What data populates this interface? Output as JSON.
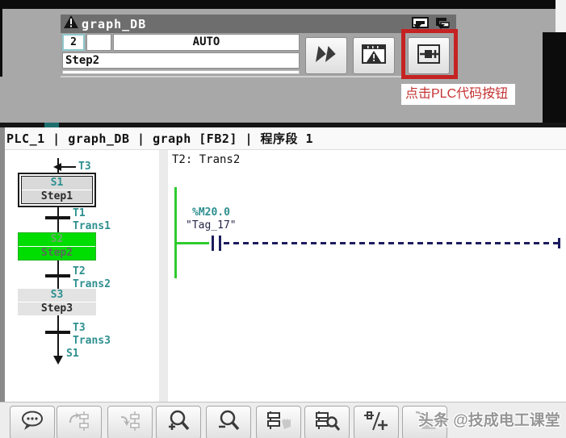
{
  "window": {
    "title": "graph_DB",
    "step_number": "2",
    "mode": "AUTO",
    "current_step": "Step2",
    "buttons": [
      {
        "icon": "fast-forward-icon"
      },
      {
        "icon": "warning-window-icon"
      },
      {
        "icon": "plc-code-icon"
      }
    ]
  },
  "callout": {
    "text": "点击PLC代码按钮"
  },
  "breadcrumb": {
    "text": "PLC_1 | graph_DB | graph [FB2] | 程序段 1"
  },
  "sequence": {
    "entry_transition": "T3",
    "steps": [
      {
        "id": "S1",
        "name": "Step1",
        "state": "selected"
      },
      {
        "id": "S2",
        "name": "Step2",
        "state": "active"
      },
      {
        "id": "S3",
        "name": "Step3",
        "state": "normal"
      }
    ],
    "transitions": [
      {
        "id": "T1",
        "name": "Trans1"
      },
      {
        "id": "T2",
        "name": "Trans2"
      },
      {
        "id": "T3",
        "name": "Trans3"
      }
    ],
    "jump_target": "S1"
  },
  "network": {
    "header": "T2: Trans2",
    "operand": "%M20.0",
    "tag": "\"Tag_17\""
  },
  "toolbar": {
    "icons": [
      "comment-icon",
      "jump-forward-icon",
      "jump-down-icon",
      "zoom-in-icon",
      "zoom-out-icon",
      "network-overview-icon",
      "network-search-icon",
      "insert-contact-icon",
      "goto-error-icon"
    ]
  },
  "watermark": {
    "text": "头条 @技成电工课堂"
  },
  "colors": {
    "highlight_red": "#c52222",
    "annotation_red": "#c53333",
    "active_step_green": "#00dd00",
    "power_rail_green": "#2ecc2e",
    "symbol_teal": "#2e8f8f",
    "wire_navy": "#1c1c5e"
  }
}
